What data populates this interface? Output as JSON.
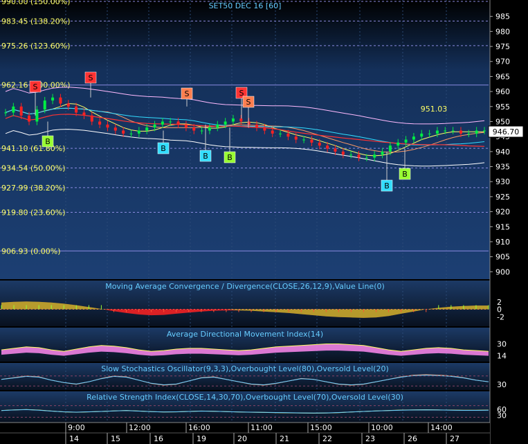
{
  "main_title": "SET50 DEC 16  [60]",
  "last_price": "946.70",
  "high_marker": "951.03",
  "fib_levels": [
    {
      "label": "990.00 (150.00%)",
      "value": 990.0
    },
    {
      "label": "983.45 (138.20%)",
      "value": 983.45
    },
    {
      "label": "975.26 (123.60%)",
      "value": 975.26
    },
    {
      "label": "962.16 (100.00%)",
      "value": 962.16
    },
    {
      "label": "941.10 (61.80%)",
      "value": 941.1
    },
    {
      "label": "934.54 (50.00%)",
      "value": 934.54
    },
    {
      "label": "927.99 (38.20%)",
      "value": 927.99
    },
    {
      "label": "919.80 (23.60%)",
      "value": 919.8
    },
    {
      "label": "906.93 (0.00%)",
      "value": 906.93
    }
  ],
  "price_axis_ticks": [
    "985",
    "980",
    "975",
    "970",
    "965",
    "960",
    "955",
    "950",
    "945",
    "940",
    "935",
    "930",
    "925",
    "920",
    "915",
    "910",
    "905",
    "900"
  ],
  "panels": {
    "macd": {
      "title": "Moving Average Convergence / Divergence(CLOSE,26,12,9),Value Line(0)",
      "ticks": [
        "2",
        "0",
        "-2"
      ]
    },
    "adx": {
      "title": "Average Directional Movement Index(14)",
      "ticks": [
        "30",
        "14"
      ]
    },
    "stoch": {
      "title": "Slow Stochastics Oscillator(9,3,3),Overbought Level(80),Oversold Level(20)",
      "ticks": [
        "30"
      ]
    },
    "rsi": {
      "title": "Relative Strength Index(CLOSE,14,30,70),Overbought Level(70),Oversold Level(30)",
      "ticks": [
        "60",
        "30"
      ]
    }
  },
  "time_axis": {
    "times": [
      "9:00",
      "12:00",
      "16:00",
      "11:00",
      "15:00",
      "10:00",
      "14:00"
    ],
    "dates": [
      "14",
      "15",
      "16",
      "19",
      "20",
      "21",
      "22",
      "23",
      "26",
      "27"
    ]
  },
  "signals": [
    {
      "type": "S",
      "label": "S",
      "color": "#ff3333"
    },
    {
      "type": "S",
      "label": "S",
      "color": "#ff3333"
    },
    {
      "type": "S",
      "label": "S",
      "color": "#ff7f50"
    },
    {
      "type": "S",
      "label": "S",
      "color": "#ff3333"
    },
    {
      "type": "S",
      "label": "S",
      "color": "#ff7f50"
    },
    {
      "type": "B",
      "label": "B",
      "color": "#99ff33"
    },
    {
      "type": "B",
      "label": "B",
      "color": "#33ddff"
    },
    {
      "type": "B",
      "label": "B",
      "color": "#33ddff"
    },
    {
      "type": "B",
      "label": "B",
      "color": "#99ff33"
    },
    {
      "type": "B",
      "label": "B",
      "color": "#33ddff"
    },
    {
      "type": "B",
      "label": "B",
      "color": "#99ff33"
    }
  ],
  "colors": {
    "background_top": "#1c3f73",
    "background_bottom": "#000000",
    "fib_label": "#ffff66",
    "axis_text": "#ffffff",
    "panel_title": "#66ccff",
    "bull_candle": "#00ee44",
    "bear_candle": "#ff2222"
  },
  "chart_data": [
    {
      "type": "candlestick",
      "title": "SET50 DEC 16  [60]",
      "ylim": [
        898,
        990
      ],
      "close_series": [
        953,
        955,
        952,
        950,
        954,
        957,
        958,
        956,
        955,
        953,
        952,
        950,
        949,
        948,
        947,
        946,
        946,
        947,
        948,
        949,
        950,
        950,
        949,
        948,
        947,
        947,
        948,
        949,
        950,
        951,
        950,
        949,
        948,
        947,
        946,
        946,
        945,
        944,
        944,
        943,
        942,
        941,
        940,
        939,
        939,
        938,
        938,
        939,
        940,
        942,
        943,
        944,
        945,
        946,
        946,
        947,
        947,
        947,
        946,
        946,
        947,
        947
      ]
    },
    {
      "type": "area",
      "title": "Moving Average Convergence / Divergence(CLOSE,26,12,9),Value Line(0)",
      "ylim": [
        -4,
        4
      ],
      "values": [
        1.8,
        2.0,
        2.1,
        2.0,
        1.8,
        1.5,
        1.1,
        0.6,
        0.1,
        -0.5,
        -1.0,
        -1.4,
        -1.6,
        -1.5,
        -1.2,
        -0.9,
        -0.6,
        -0.4,
        -0.3,
        -0.3,
        -0.4,
        -0.6,
        -0.8,
        -1.0,
        -1.3,
        -1.6,
        -1.9,
        -2.1,
        -2.2,
        -2.3,
        -2.2,
        -1.8,
        -1.2,
        -0.6,
        0.0,
        0.4,
        0.7,
        0.9,
        1.0,
        1.0
      ]
    },
    {
      "type": "area",
      "title": "Average Directional Movement Index(14)",
      "ylim": [
        8,
        38
      ],
      "values": [
        22,
        24,
        26,
        25,
        22,
        20,
        23,
        26,
        28,
        27,
        25,
        22,
        20,
        21,
        23,
        24,
        24,
        23,
        22,
        21,
        22,
        24,
        26,
        27,
        28,
        29,
        30,
        30,
        29,
        28,
        25,
        22,
        20,
        22,
        24,
        25,
        24,
        22,
        21,
        20
      ]
    },
    {
      "type": "line",
      "title": "Slow Stochastics Oscillator(9,3,3),Overbought Level(80),Oversold Level(20)",
      "ylim": [
        0,
        100
      ],
      "values": [
        60,
        70,
        80,
        75,
        55,
        40,
        30,
        45,
        65,
        80,
        75,
        55,
        35,
        25,
        30,
        50,
        70,
        75,
        60,
        45,
        30,
        25,
        35,
        50,
        65,
        60,
        45,
        30,
        25,
        30,
        45,
        60,
        75,
        85,
        88,
        85,
        80,
        70,
        55,
        45
      ]
    },
    {
      "type": "line",
      "title": "Relative Strength Index(CLOSE,14,30,70),Overbought Level(70),Oversold Level(30)",
      "ylim": [
        0,
        100
      ],
      "values": [
        55,
        58,
        60,
        57,
        52,
        48,
        46,
        48,
        50,
        53,
        55,
        52,
        49,
        47,
        48,
        50,
        52,
        51,
        49,
        47,
        46,
        45,
        44,
        43,
        42,
        41,
        42,
        44,
        47,
        50,
        53,
        55,
        57,
        58,
        59,
        58,
        57,
        56,
        56,
        57
      ]
    }
  ]
}
